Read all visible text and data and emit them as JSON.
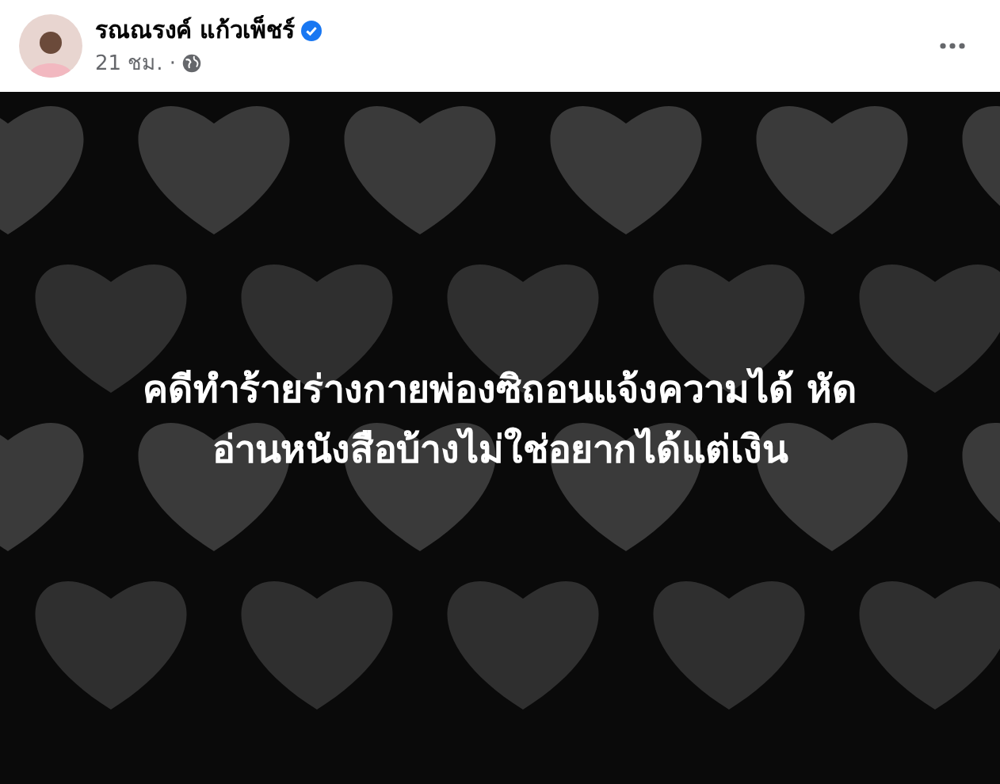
{
  "post": {
    "author": "รณณรงค์ แก้วเพ็ชร์",
    "verified": true,
    "time": "21 ชม.",
    "separator": "·",
    "text_lines": [
      "คดีทำร้ายร่างกายพ่องซิถอนแจ้งความได้ หัด",
      "อ่านหนังสือบ้างไม่ใช่อยากได้แต่เงิน"
    ]
  }
}
